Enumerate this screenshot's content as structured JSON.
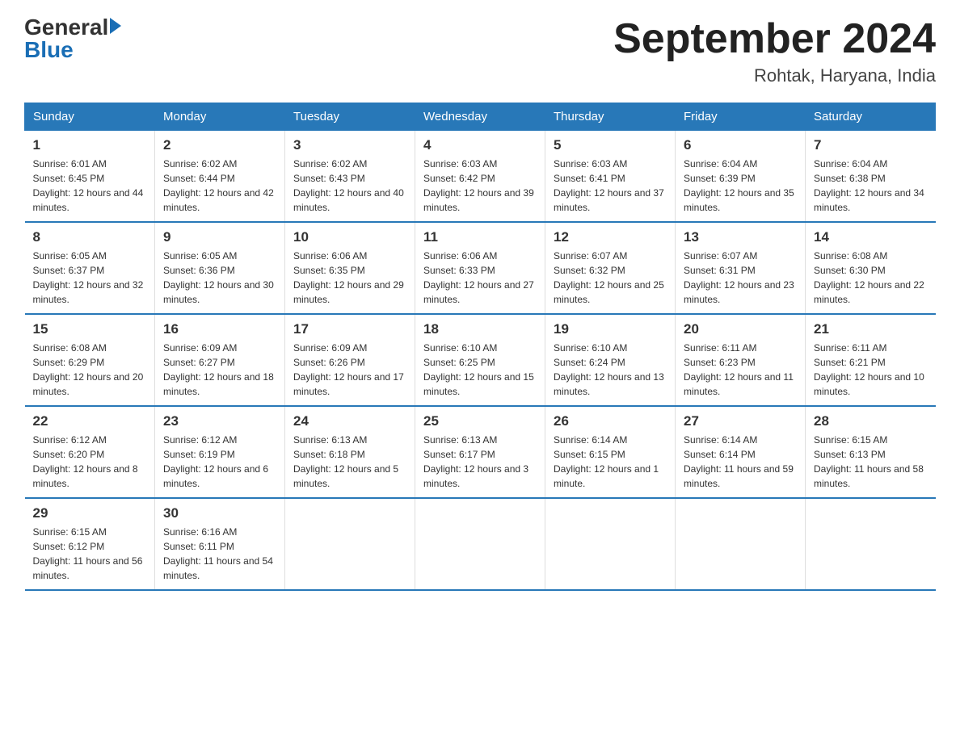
{
  "header": {
    "logo_general": "General",
    "logo_blue": "Blue",
    "title": "September 2024",
    "location": "Rohtak, Haryana, India"
  },
  "days_of_week": [
    "Sunday",
    "Monday",
    "Tuesday",
    "Wednesday",
    "Thursday",
    "Friday",
    "Saturday"
  ],
  "weeks": [
    [
      {
        "day": "1",
        "sunrise": "Sunrise: 6:01 AM",
        "sunset": "Sunset: 6:45 PM",
        "daylight": "Daylight: 12 hours and 44 minutes."
      },
      {
        "day": "2",
        "sunrise": "Sunrise: 6:02 AM",
        "sunset": "Sunset: 6:44 PM",
        "daylight": "Daylight: 12 hours and 42 minutes."
      },
      {
        "day": "3",
        "sunrise": "Sunrise: 6:02 AM",
        "sunset": "Sunset: 6:43 PM",
        "daylight": "Daylight: 12 hours and 40 minutes."
      },
      {
        "day": "4",
        "sunrise": "Sunrise: 6:03 AM",
        "sunset": "Sunset: 6:42 PM",
        "daylight": "Daylight: 12 hours and 39 minutes."
      },
      {
        "day": "5",
        "sunrise": "Sunrise: 6:03 AM",
        "sunset": "Sunset: 6:41 PM",
        "daylight": "Daylight: 12 hours and 37 minutes."
      },
      {
        "day": "6",
        "sunrise": "Sunrise: 6:04 AM",
        "sunset": "Sunset: 6:39 PM",
        "daylight": "Daylight: 12 hours and 35 minutes."
      },
      {
        "day": "7",
        "sunrise": "Sunrise: 6:04 AM",
        "sunset": "Sunset: 6:38 PM",
        "daylight": "Daylight: 12 hours and 34 minutes."
      }
    ],
    [
      {
        "day": "8",
        "sunrise": "Sunrise: 6:05 AM",
        "sunset": "Sunset: 6:37 PM",
        "daylight": "Daylight: 12 hours and 32 minutes."
      },
      {
        "day": "9",
        "sunrise": "Sunrise: 6:05 AM",
        "sunset": "Sunset: 6:36 PM",
        "daylight": "Daylight: 12 hours and 30 minutes."
      },
      {
        "day": "10",
        "sunrise": "Sunrise: 6:06 AM",
        "sunset": "Sunset: 6:35 PM",
        "daylight": "Daylight: 12 hours and 29 minutes."
      },
      {
        "day": "11",
        "sunrise": "Sunrise: 6:06 AM",
        "sunset": "Sunset: 6:33 PM",
        "daylight": "Daylight: 12 hours and 27 minutes."
      },
      {
        "day": "12",
        "sunrise": "Sunrise: 6:07 AM",
        "sunset": "Sunset: 6:32 PM",
        "daylight": "Daylight: 12 hours and 25 minutes."
      },
      {
        "day": "13",
        "sunrise": "Sunrise: 6:07 AM",
        "sunset": "Sunset: 6:31 PM",
        "daylight": "Daylight: 12 hours and 23 minutes."
      },
      {
        "day": "14",
        "sunrise": "Sunrise: 6:08 AM",
        "sunset": "Sunset: 6:30 PM",
        "daylight": "Daylight: 12 hours and 22 minutes."
      }
    ],
    [
      {
        "day": "15",
        "sunrise": "Sunrise: 6:08 AM",
        "sunset": "Sunset: 6:29 PM",
        "daylight": "Daylight: 12 hours and 20 minutes."
      },
      {
        "day": "16",
        "sunrise": "Sunrise: 6:09 AM",
        "sunset": "Sunset: 6:27 PM",
        "daylight": "Daylight: 12 hours and 18 minutes."
      },
      {
        "day": "17",
        "sunrise": "Sunrise: 6:09 AM",
        "sunset": "Sunset: 6:26 PM",
        "daylight": "Daylight: 12 hours and 17 minutes."
      },
      {
        "day": "18",
        "sunrise": "Sunrise: 6:10 AM",
        "sunset": "Sunset: 6:25 PM",
        "daylight": "Daylight: 12 hours and 15 minutes."
      },
      {
        "day": "19",
        "sunrise": "Sunrise: 6:10 AM",
        "sunset": "Sunset: 6:24 PM",
        "daylight": "Daylight: 12 hours and 13 minutes."
      },
      {
        "day": "20",
        "sunrise": "Sunrise: 6:11 AM",
        "sunset": "Sunset: 6:23 PM",
        "daylight": "Daylight: 12 hours and 11 minutes."
      },
      {
        "day": "21",
        "sunrise": "Sunrise: 6:11 AM",
        "sunset": "Sunset: 6:21 PM",
        "daylight": "Daylight: 12 hours and 10 minutes."
      }
    ],
    [
      {
        "day": "22",
        "sunrise": "Sunrise: 6:12 AM",
        "sunset": "Sunset: 6:20 PM",
        "daylight": "Daylight: 12 hours and 8 minutes."
      },
      {
        "day": "23",
        "sunrise": "Sunrise: 6:12 AM",
        "sunset": "Sunset: 6:19 PM",
        "daylight": "Daylight: 12 hours and 6 minutes."
      },
      {
        "day": "24",
        "sunrise": "Sunrise: 6:13 AM",
        "sunset": "Sunset: 6:18 PM",
        "daylight": "Daylight: 12 hours and 5 minutes."
      },
      {
        "day": "25",
        "sunrise": "Sunrise: 6:13 AM",
        "sunset": "Sunset: 6:17 PM",
        "daylight": "Daylight: 12 hours and 3 minutes."
      },
      {
        "day": "26",
        "sunrise": "Sunrise: 6:14 AM",
        "sunset": "Sunset: 6:15 PM",
        "daylight": "Daylight: 12 hours and 1 minute."
      },
      {
        "day": "27",
        "sunrise": "Sunrise: 6:14 AM",
        "sunset": "Sunset: 6:14 PM",
        "daylight": "Daylight: 11 hours and 59 minutes."
      },
      {
        "day": "28",
        "sunrise": "Sunrise: 6:15 AM",
        "sunset": "Sunset: 6:13 PM",
        "daylight": "Daylight: 11 hours and 58 minutes."
      }
    ],
    [
      {
        "day": "29",
        "sunrise": "Sunrise: 6:15 AM",
        "sunset": "Sunset: 6:12 PM",
        "daylight": "Daylight: 11 hours and 56 minutes."
      },
      {
        "day": "30",
        "sunrise": "Sunrise: 6:16 AM",
        "sunset": "Sunset: 6:11 PM",
        "daylight": "Daylight: 11 hours and 54 minutes."
      },
      {
        "day": "",
        "sunrise": "",
        "sunset": "",
        "daylight": ""
      },
      {
        "day": "",
        "sunrise": "",
        "sunset": "",
        "daylight": ""
      },
      {
        "day": "",
        "sunrise": "",
        "sunset": "",
        "daylight": ""
      },
      {
        "day": "",
        "sunrise": "",
        "sunset": "",
        "daylight": ""
      },
      {
        "day": "",
        "sunrise": "",
        "sunset": "",
        "daylight": ""
      }
    ]
  ]
}
